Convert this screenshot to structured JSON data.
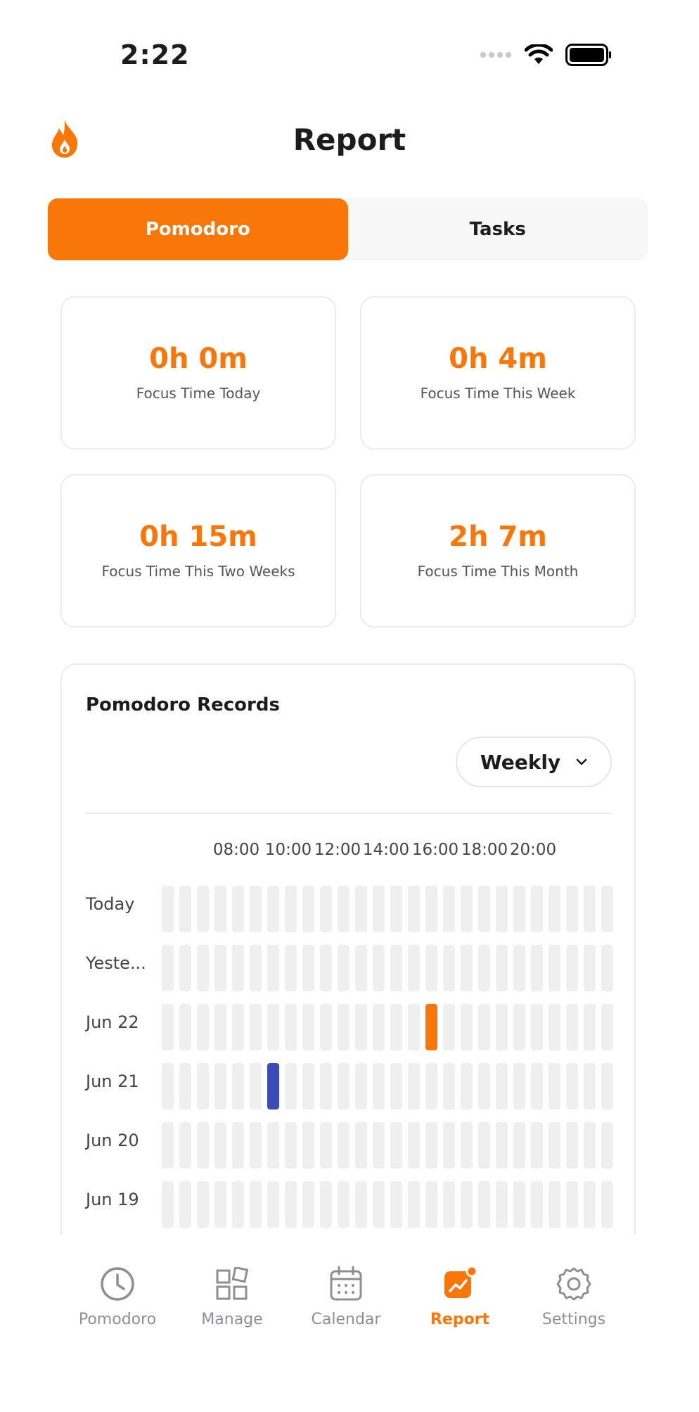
{
  "status_bar": {
    "time": "2:22"
  },
  "header": {
    "title": "Report"
  },
  "segments": [
    {
      "label": "Pomodoro",
      "active": true
    },
    {
      "label": "Tasks",
      "active": false
    }
  ],
  "stats": [
    {
      "value": "0h 0m",
      "label": "Focus Time Today"
    },
    {
      "value": "0h 4m",
      "label": "Focus Time This Week"
    },
    {
      "value": "0h 15m",
      "label": "Focus Time This Two Weeks"
    },
    {
      "value": "2h 7m",
      "label": "Focus Time This Month"
    }
  ],
  "records": {
    "title": "Pomodoro Records",
    "period": "Weekly",
    "hour_labels": [
      "08:00",
      "10:00",
      "12:00",
      "14:00",
      "16:00",
      "18:00",
      "20:00"
    ],
    "rows": [
      {
        "label": "Today"
      },
      {
        "label": "Yeste..."
      },
      {
        "label": "Jun 22"
      },
      {
        "label": "Jun 21"
      },
      {
        "label": "Jun 20"
      },
      {
        "label": "Jun 19"
      }
    ]
  },
  "tabs": [
    {
      "label": "Pomodoro",
      "icon": "clock-icon",
      "active": false
    },
    {
      "label": "Manage",
      "icon": "grid-icon",
      "active": false
    },
    {
      "label": "Calendar",
      "icon": "calendar-icon",
      "active": false
    },
    {
      "label": "Report",
      "icon": "chart-icon",
      "active": true
    },
    {
      "label": "Settings",
      "icon": "gear-icon",
      "active": false
    }
  ],
  "colors": {
    "accent": "#f97709",
    "secondary_session": "#3b4cb8"
  }
}
